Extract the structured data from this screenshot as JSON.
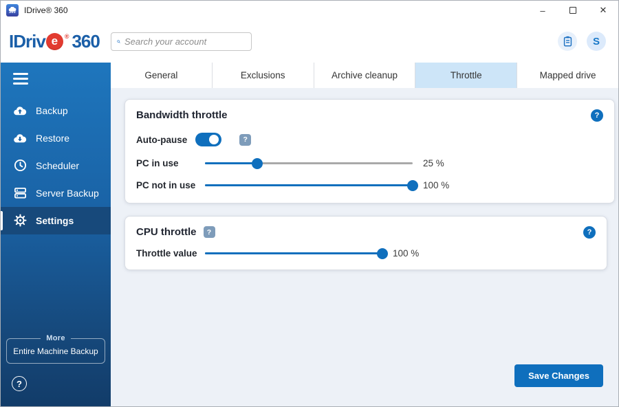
{
  "window": {
    "title": "IDrive® 360",
    "icon_label": "360",
    "controls": {
      "minimize": "–",
      "close": "✕"
    }
  },
  "header": {
    "logo": {
      "part1": "IDriv",
      "e": "e",
      "reg": "®",
      "part2": "360"
    },
    "search_placeholder": "Search your account",
    "avatar_initial": "S"
  },
  "sidebar": {
    "items": [
      {
        "label": "Backup",
        "icon": "cloud-upload-icon",
        "active": false
      },
      {
        "label": "Restore",
        "icon": "cloud-download-icon",
        "active": false
      },
      {
        "label": "Scheduler",
        "icon": "clock-icon",
        "active": false
      },
      {
        "label": "Server Backup",
        "icon": "server-icon",
        "active": false
      },
      {
        "label": "Settings",
        "icon": "gear-icon",
        "active": true
      }
    ],
    "more_label": "More",
    "more_button": "Entire Machine Backup",
    "help_glyph": "?"
  },
  "tabs": [
    {
      "label": "General",
      "active": false
    },
    {
      "label": "Exclusions",
      "active": false
    },
    {
      "label": "Archive cleanup",
      "active": false
    },
    {
      "label": "Throttle",
      "active": true
    },
    {
      "label": "Mapped drive",
      "active": false
    }
  ],
  "main": {
    "bandwidth": {
      "title": "Bandwidth throttle",
      "help_glyph": "?",
      "auto_pause": {
        "label": "Auto-pause",
        "enabled": true,
        "help_glyph": "?"
      },
      "sliders": [
        {
          "label": "PC in use",
          "value": 25,
          "display": "25 %"
        },
        {
          "label": "PC not in use",
          "value": 100,
          "display": "100 %"
        }
      ]
    },
    "cpu": {
      "title": "CPU throttle",
      "help_glyph": "?",
      "title_help_glyph": "?",
      "sliders": [
        {
          "label": "Throttle value",
          "value": 100,
          "display": "100 %"
        }
      ]
    },
    "save_label": "Save Changes"
  },
  "colors": {
    "accent_blue": "#0f6fbd",
    "sidebar_top": "#1e76bd",
    "sidebar_bottom": "#123c69",
    "sidebar_active": "#17497b",
    "tab_active_bg": "#cde5f8",
    "content_bg": "#edf1f7",
    "logo_blue": "#1b5fa8",
    "logo_red": "#e23b30",
    "slider_track_gray": "#a9a9a9"
  }
}
